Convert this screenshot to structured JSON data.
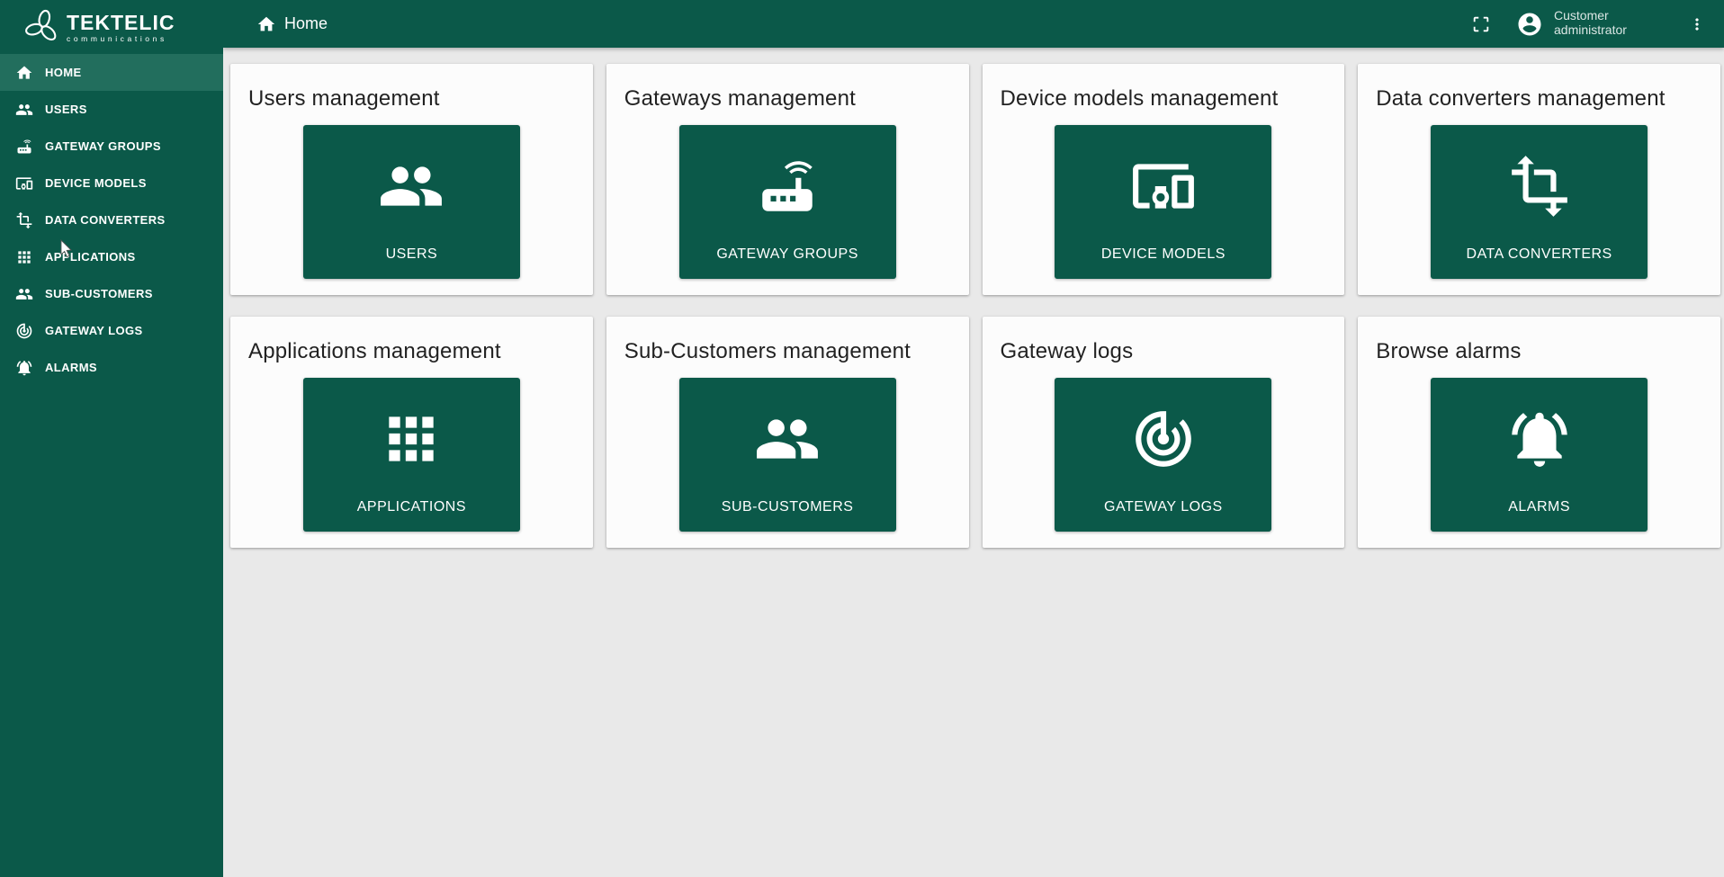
{
  "brand": {
    "name": "TEKTELIC",
    "tagline": "communications",
    "logo_icon": "tektelic-leaf-icon"
  },
  "topbar": {
    "breadcrumb": {
      "icon": "home-icon",
      "label": "Home"
    },
    "fullscreen_icon": "fullscreen-icon",
    "avatar_icon": "account-circle-icon",
    "user_label": "Customer administrator",
    "menu_icon": "more-vert-icon"
  },
  "sidebar": {
    "items": [
      {
        "label": "HOME",
        "icon": "home-icon",
        "active": true
      },
      {
        "label": "USERS",
        "icon": "people-icon",
        "active": false
      },
      {
        "label": "GATEWAY GROUPS",
        "icon": "router-icon",
        "active": false
      },
      {
        "label": "DEVICE MODELS",
        "icon": "devices-icon",
        "active": false
      },
      {
        "label": "DATA CONVERTERS",
        "icon": "transform-icon",
        "active": false
      },
      {
        "label": "APPLICATIONS",
        "icon": "apps-grid-icon",
        "active": false
      },
      {
        "label": "SUB-CUSTOMERS",
        "icon": "people-icon",
        "active": false
      },
      {
        "label": "GATEWAY LOGS",
        "icon": "track-changes-icon",
        "active": false
      },
      {
        "label": "ALARMS",
        "icon": "alarm-bell-icon",
        "active": false
      }
    ]
  },
  "cards": [
    {
      "title": "Users management",
      "tile_label": "USERS",
      "icon": "people-icon"
    },
    {
      "title": "Gateways management",
      "tile_label": "GATEWAY GROUPS",
      "icon": "router-icon"
    },
    {
      "title": "Device models management",
      "tile_label": "DEVICE MODELS",
      "icon": "devices-icon"
    },
    {
      "title": "Data converters management",
      "tile_label": "DATA CONVERTERS",
      "icon": "transform-icon"
    },
    {
      "title": "Applications management",
      "tile_label": "APPLICATIONS",
      "icon": "apps-grid-icon"
    },
    {
      "title": "Sub-Customers management",
      "tile_label": "SUB-CUSTOMERS",
      "icon": "people-icon"
    },
    {
      "title": "Gateway logs",
      "tile_label": "GATEWAY LOGS",
      "icon": "track-changes-icon"
    },
    {
      "title": "Browse alarms",
      "tile_label": "ALARMS",
      "icon": "alarm-bell-icon"
    }
  ],
  "colors": {
    "primary_green": "#0b5949",
    "sidebar_active": "#226e5d",
    "content_bg": "#e9e9e9",
    "card_bg": "#fcfcfc",
    "tile_text": "#ffffff"
  }
}
